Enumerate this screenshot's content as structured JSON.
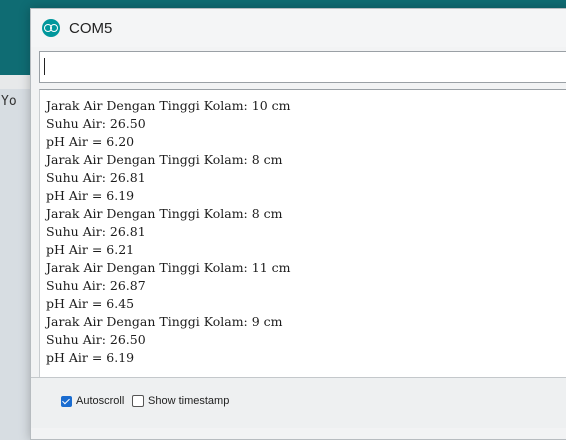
{
  "background": {
    "left_text": "Yo"
  },
  "window": {
    "title": "COM5",
    "icon": "arduino-icon",
    "accent_color": "#00979c"
  },
  "input": {
    "value": ""
  },
  "serial_output": [
    "Jarak Air Dengan Tinggi Kolam: 10 cm",
    "Suhu Air: 26.50",
    "pH Air = 6.20",
    "Jarak Air Dengan Tinggi Kolam: 8 cm",
    "Suhu Air: 26.81",
    "pH Air = 6.19",
    "Jarak Air Dengan Tinggi Kolam: 8 cm",
    "Suhu Air: 26.81",
    "pH Air = 6.21",
    "Jarak Air Dengan Tinggi Kolam: 11 cm",
    "Suhu Air: 26.87",
    "pH Air = 6.45",
    "Jarak Air Dengan Tinggi Kolam: 9 cm",
    "Suhu Air: 26.50",
    "pH Air = 6.19"
  ],
  "bottom": {
    "autoscroll_label": "Autoscroll",
    "autoscroll_checked": true,
    "timestamp_label": "Show timestamp",
    "timestamp_checked": false
  }
}
